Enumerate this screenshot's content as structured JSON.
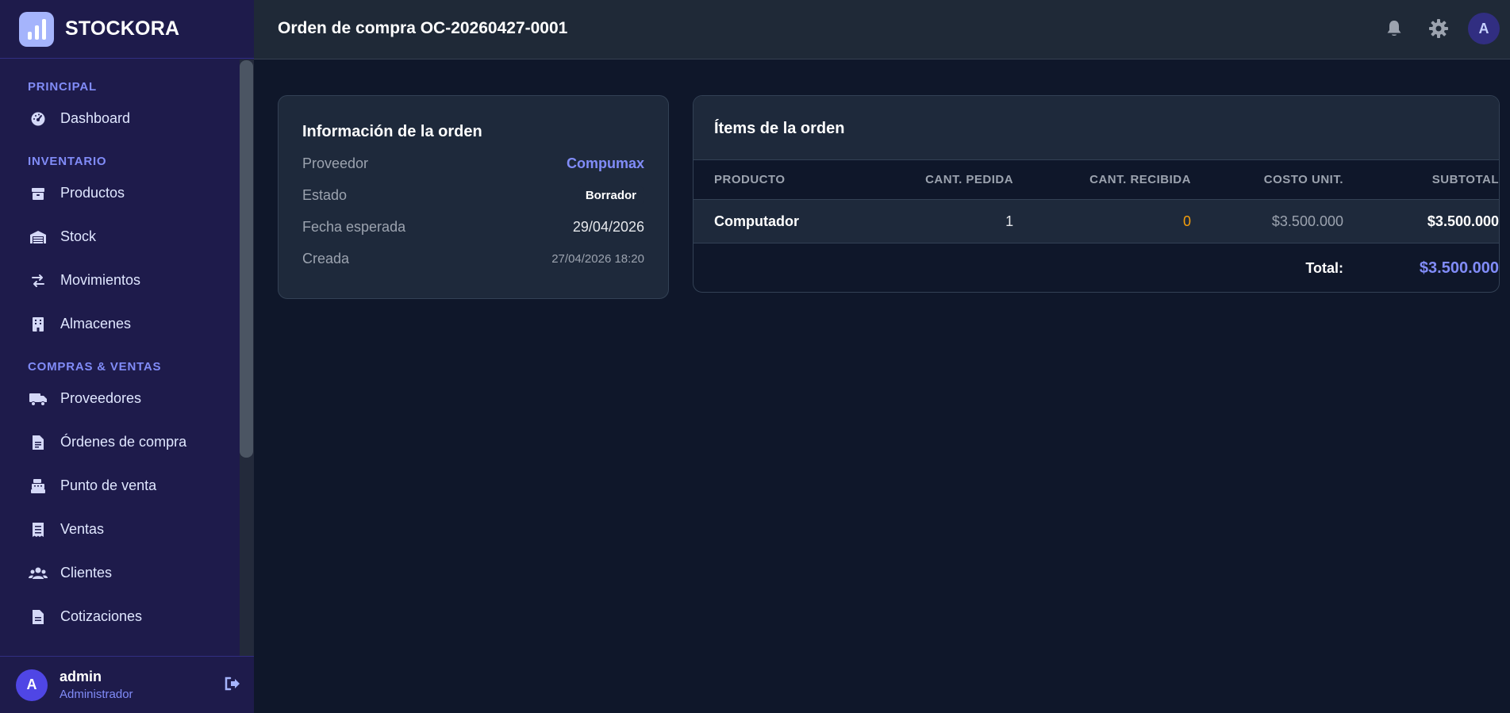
{
  "brand": {
    "name": "STOCKORA"
  },
  "header": {
    "title": "Orden de compra OC-20260427-0001",
    "avatar_initial": "A"
  },
  "sidebar": {
    "sections": [
      {
        "title": "PRINCIPAL",
        "items": [
          {
            "label": "Dashboard",
            "icon": "gauge-icon"
          }
        ]
      },
      {
        "title": "INVENTARIO",
        "items": [
          {
            "label": "Productos",
            "icon": "box-icon"
          },
          {
            "label": "Stock",
            "icon": "warehouse-icon"
          },
          {
            "label": "Movimientos",
            "icon": "arrows-icon"
          },
          {
            "label": "Almacenes",
            "icon": "building-icon"
          }
        ]
      },
      {
        "title": "COMPRAS & VENTAS",
        "items": [
          {
            "label": "Proveedores",
            "icon": "truck-icon"
          },
          {
            "label": "Órdenes de compra",
            "icon": "invoice-icon"
          },
          {
            "label": "Punto de venta",
            "icon": "cash-register-icon"
          },
          {
            "label": "Ventas",
            "icon": "receipt-icon"
          },
          {
            "label": "Clientes",
            "icon": "users-icon"
          },
          {
            "label": "Cotizaciones",
            "icon": "document-icon"
          }
        ]
      }
    ]
  },
  "user": {
    "initial": "A",
    "name": "admin",
    "role": "Administrador"
  },
  "order_info": {
    "title": "Información de la orden",
    "rows": [
      {
        "label": "Proveedor",
        "value": "Compumax"
      },
      {
        "label": "Estado",
        "value": "Borrador"
      },
      {
        "label": "Fecha esperada",
        "value": "29/04/2026"
      },
      {
        "label": "Creada",
        "value": "27/04/2026 18:20"
      }
    ]
  },
  "items": {
    "title": "Ítems de la orden",
    "columns": [
      "PRODUCTO",
      "CANT. PEDIDA",
      "CANT. RECIBIDA",
      "COSTO UNIT.",
      "SUBTOTAL"
    ],
    "rows": [
      {
        "producto": "Computador",
        "cant_pedida": "1",
        "cant_recibida": "0",
        "costo_unit": "$3.500.000",
        "subtotal": "$3.500.000"
      }
    ],
    "total_label": "Total:",
    "total_value": "$3.500.000"
  },
  "colors": {
    "accent": "#818cf8",
    "sidebar_bg": "#1e1b4b",
    "main_bg": "#0f172a",
    "card_bg": "#1e293b",
    "warning": "#f59e0b"
  }
}
